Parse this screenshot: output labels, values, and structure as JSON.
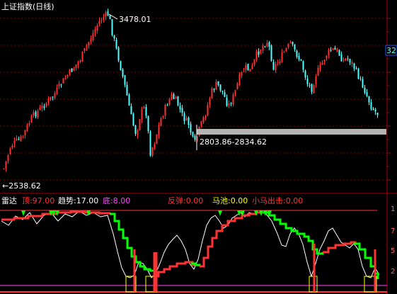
{
  "main": {
    "title": "上证指数(日线)",
    "high_label": "3478.01",
    "low_label": "←2538.62",
    "range_label": "2803.86-2834.62",
    "right_badge": "32"
  },
  "indicator": {
    "name": "雷达",
    "items": [
      {
        "label": "顶:97.00",
        "color": "#ff3333"
      },
      {
        "label": "趋势:17.00",
        "color": "#ffffff"
      },
      {
        "label": "底:8.00",
        "color": "#ff44ff"
      },
      {
        "label": "反弹:0.00",
        "color": "#ff3333"
      },
      {
        "label": "马池:0.00",
        "color": "#ffff00"
      },
      {
        "label": "小马出击:0.00",
        "color": "#ff3333"
      }
    ],
    "right_ticks": [
      "1",
      "7",
      "5",
      "2"
    ]
  },
  "chart_data": {
    "type": "candlestick",
    "series": [
      {
        "name": "price",
        "high": 3478.01,
        "low": 2538.62
      }
    ],
    "support_band": [
      2803.86,
      2834.62
    ],
    "indicator_levels": {
      "top": 97,
      "trend": 17,
      "bottom": 8,
      "rebound": 0,
      "horse_pool": 0,
      "horse_attack": 0
    }
  },
  "colors": {
    "up": "#ff3333",
    "down": "#54ffff",
    "grid": "#8b0000",
    "green": "#00ff00",
    "white": "#ffffff",
    "magenta": "#ff44ff"
  }
}
